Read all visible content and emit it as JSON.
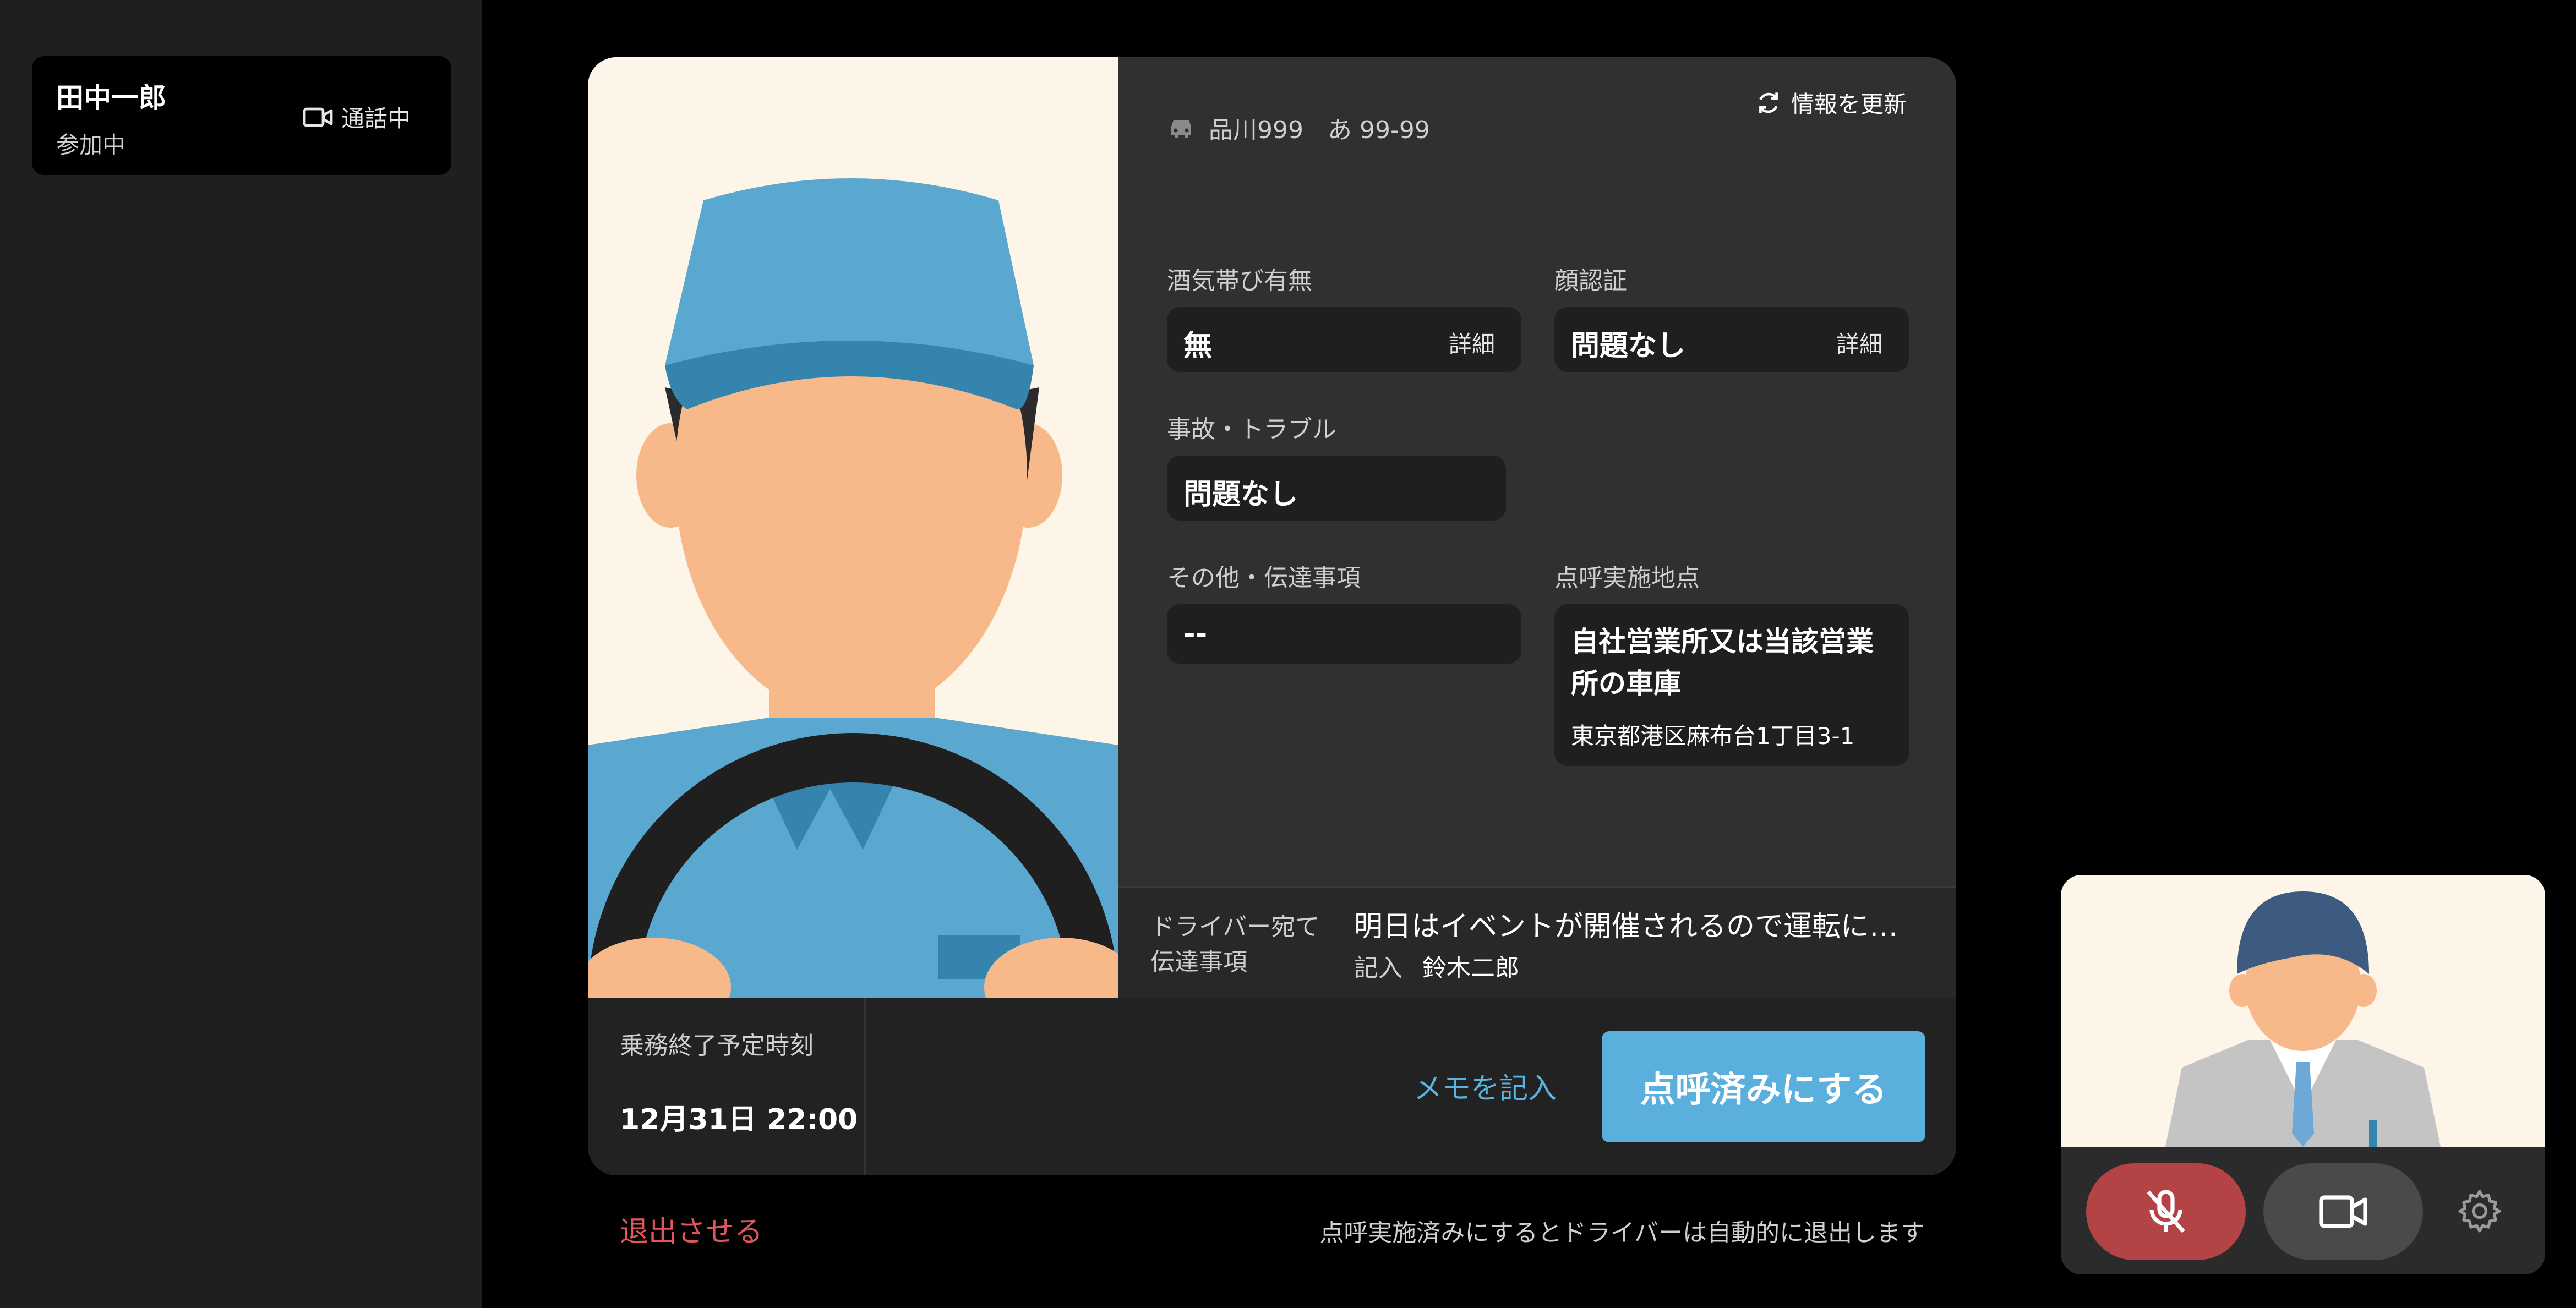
{
  "participant": {
    "name": "田中一郎",
    "status": "参加中",
    "call_status": "通話中"
  },
  "info": {
    "refresh_label": "情報を更新",
    "plate": "品川999　あ 99-99",
    "alcohol": {
      "label": "酒気帯び有無",
      "value": "無",
      "detail": "詳細"
    },
    "face": {
      "label": "顔認証",
      "value": "問題なし",
      "detail": "詳細"
    },
    "accident": {
      "label": "事故・トラブル",
      "value": "問題なし"
    },
    "other": {
      "label": "その他・伝達事項",
      "value": "--"
    },
    "location": {
      "label": "点呼実施地点",
      "value": "自社営業所又は当該営業所の車庫",
      "address": "東京都港区麻布台1丁目3-1"
    }
  },
  "message": {
    "label_line1": "ドライバー宛て",
    "label_line2": "伝達事項",
    "text": "明日はイベントが開催されるので運転に注意してください",
    "writer_label": "記入",
    "writer_name": "鈴木二郎"
  },
  "footer": {
    "end_label": "乗務終了予定時刻",
    "end_time": "12月31日  22:00",
    "memo_label": "メモを記入",
    "done_label": "点呼済みにする",
    "kick_label": "退出させる",
    "note": "点呼実施済みにするとドライバーは自動的に退出します"
  },
  "icons": [
    "video-camera-icon",
    "refresh-icon",
    "car-icon",
    "mic-off-icon",
    "video-camera-icon",
    "gear-icon"
  ],
  "colors": {
    "accent": "#5aafdc",
    "danger": "#e0575a",
    "mic_off_bg": "#b44346"
  }
}
